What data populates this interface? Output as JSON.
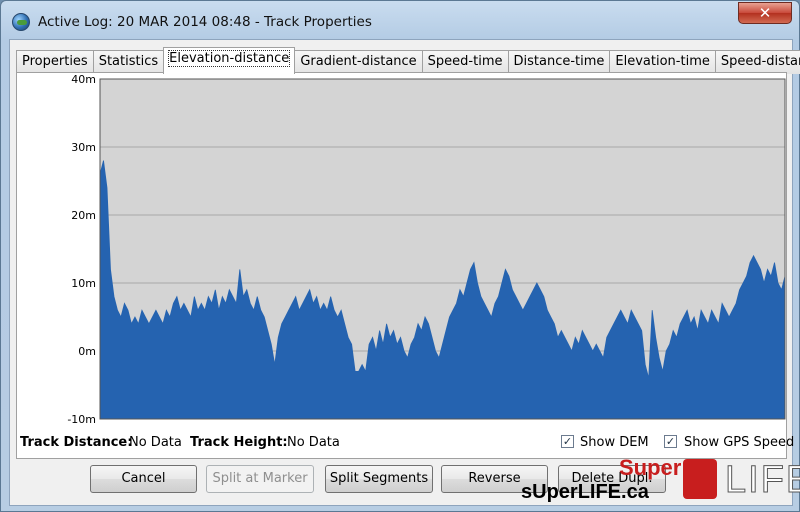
{
  "window": {
    "title": "Active Log: 20 MAR 2014 08:48 - Track Properties",
    "close_label": "✕"
  },
  "tabs": [
    {
      "label": "Properties"
    },
    {
      "label": "Statistics"
    },
    {
      "label": "Elevation-distance",
      "active": true
    },
    {
      "label": "Gradient-distance"
    },
    {
      "label": "Speed-time"
    },
    {
      "label": "Distance-time"
    },
    {
      "label": "Elevation-time"
    },
    {
      "label": "Speed-distance"
    }
  ],
  "chart_data": {
    "type": "area",
    "title": "",
    "xlabel": "",
    "ylabel": "",
    "ylim": [
      -10,
      40
    ],
    "yticks": [
      "40m",
      "30m",
      "20m",
      "10m",
      "0m",
      "-10m"
    ],
    "grid": true,
    "colors": {
      "fill": "#2563b0",
      "background": "#d4d4d4",
      "grid": "#a8a8a8"
    },
    "values": [
      26,
      28,
      24,
      12,
      8,
      6,
      5,
      7,
      6,
      4,
      5,
      4,
      6,
      5,
      4,
      5,
      6,
      5,
      4,
      6,
      5,
      7,
      8,
      6,
      7,
      6,
      5,
      8,
      6,
      7,
      6,
      8,
      7,
      9,
      6,
      8,
      7,
      9,
      8,
      7,
      12,
      8,
      9,
      7,
      6,
      8,
      6,
      5,
      3,
      1,
      -2,
      2,
      4,
      5,
      6,
      7,
      8,
      6,
      7,
      8,
      9,
      7,
      8,
      6,
      7,
      6,
      8,
      6,
      5,
      6,
      4,
      2,
      1,
      -3,
      -3,
      -2,
      -3,
      1,
      2,
      0,
      3,
      1,
      4,
      2,
      3,
      1,
      2,
      0,
      -1,
      1,
      2,
      4,
      3,
      5,
      4,
      2,
      0,
      -1,
      1,
      3,
      5,
      6,
      7,
      9,
      8,
      10,
      12,
      13,
      10,
      8,
      7,
      6,
      5,
      7,
      8,
      10,
      12,
      11,
      9,
      8,
      7,
      6,
      7,
      8,
      9,
      10,
      9,
      8,
      6,
      5,
      4,
      2,
      3,
      2,
      1,
      0,
      2,
      1,
      3,
      2,
      1,
      0,
      1,
      0,
      -1,
      2,
      3,
      4,
      5,
      6,
      5,
      4,
      6,
      5,
      4,
      3,
      -2,
      -4,
      6,
      2,
      -1,
      -3,
      0,
      1,
      3,
      2,
      4,
      5,
      6,
      4,
      5,
      3,
      6,
      5,
      4,
      6,
      5,
      4,
      7,
      6,
      5,
      6,
      7,
      9,
      10,
      11,
      13,
      14,
      13,
      12,
      10,
      12,
      11,
      13,
      10,
      9,
      11
    ]
  },
  "info": {
    "distance_label": "Track Distance:",
    "distance_value": "No Data",
    "height_label": "Track Height:",
    "height_value": "No Data",
    "show_dem": {
      "label": "Show DEM",
      "checked": true
    },
    "show_gps_speed": {
      "label": "Show GPS Speed",
      "checked": true
    }
  },
  "buttons": {
    "cancel": "Cancel",
    "split_at_marker": "Split at Marker",
    "split_segments": "Split Segments",
    "reverse": "Reverse",
    "delete_dupl": "Delete Dupl."
  },
  "watermark": {
    "text": "sUperLIFE.ca",
    "super": "Super",
    "life": "LIFE"
  }
}
